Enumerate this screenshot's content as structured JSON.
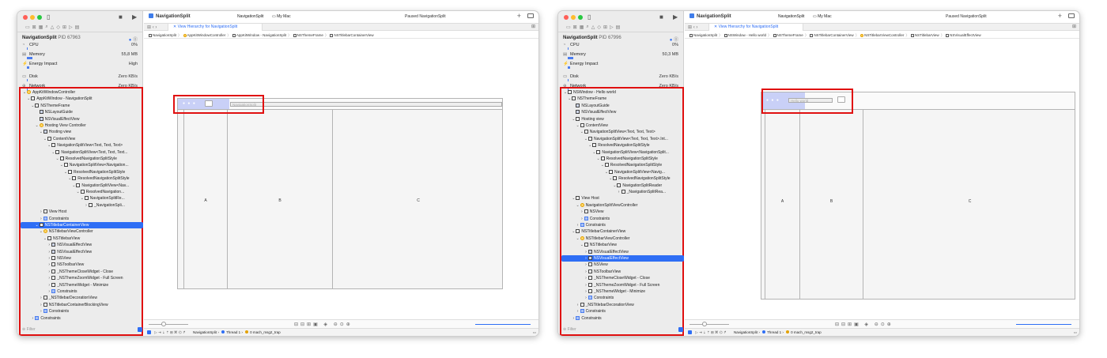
{
  "windows": [
    {
      "app_name": "NavigationSplit",
      "scheme": "NavigationSplit",
      "destination": "My Mac",
      "status": "Paused NavigationSplit",
      "tab_label": "View Hierarchy for NavigationSplit",
      "process_name": "NavigationSplit",
      "pid": "PID 67963",
      "gauges": [
        {
          "label": "CPU",
          "value": "0%",
          "fill": 0.0
        },
        {
          "label": "Memory",
          "value": "55,8 MB",
          "fill": 0.12
        },
        {
          "label": "Energy Impact",
          "value": "High",
          "fill": 0.05
        },
        {
          "label": "Disk",
          "value": "Zero KB/s",
          "fill": 0.0
        },
        {
          "label": "Network",
          "value": "Zero KB/s",
          "fill": 0.0
        }
      ],
      "breadcrumbs": [
        "NavigationSplit",
        "AppKitWindowController",
        "AppKitWindow - NavigationSplit",
        "NSThemeFrame",
        "NSTitlebarContainerView"
      ],
      "breadcrumb_kinds": [
        "",
        "o",
        "",
        "",
        ""
      ],
      "tree": [
        {
          "d": 0,
          "t": "AppKitWindowController",
          "k": "vc",
          "o": "v"
        },
        {
          "d": 1,
          "t": "AppKitWindow - NavigationSplit",
          "k": "box",
          "o": "v"
        },
        {
          "d": 2,
          "t": "NSThemeFrame",
          "k": "box",
          "o": "v"
        },
        {
          "d": 3,
          "t": "NSLayoutGuide",
          "k": "fx",
          "o": ""
        },
        {
          "d": 3,
          "t": "NSVisualEffectView",
          "k": "fx",
          "o": ""
        },
        {
          "d": 3,
          "t": "Hosting View Controller",
          "k": "vc",
          "o": "v"
        },
        {
          "d": 4,
          "t": "Hosting view",
          "k": "fx",
          "o": "v"
        },
        {
          "d": 5,
          "t": "ContentView",
          "k": "box",
          "o": "v"
        },
        {
          "d": 6,
          "t": "NavigationSplitView<Text, Text, Text>",
          "k": "box",
          "o": "v"
        },
        {
          "d": 7,
          "t": "NavigationSplitView<Text, Text, Text...",
          "k": "box",
          "o": "v"
        },
        {
          "d": 8,
          "t": "ResolvedNavigationSplitStyle",
          "k": "box",
          "o": "v"
        },
        {
          "d": 9,
          "t": "NavigationSplitView<Navigation...",
          "k": "box",
          "o": "v"
        },
        {
          "d": 10,
          "t": "ResolvedNavigationSplitStyle",
          "k": "box",
          "o": "v"
        },
        {
          "d": 11,
          "t": "ResolvedNavigationSplitStyle",
          "k": "box",
          "o": "v"
        },
        {
          "d": 12,
          "t": "NavigationSplitView<Nav...",
          "k": "box",
          "o": "v"
        },
        {
          "d": 13,
          "t": "ResolvedNavigation...",
          "k": "box",
          "o": "v"
        },
        {
          "d": 14,
          "t": "NavigationSplitRe...",
          "k": "box",
          "o": "v"
        },
        {
          "d": 15,
          "t": "_NavigationSpli...",
          "k": "box",
          "o": ">"
        },
        {
          "d": 4,
          "t": "View Host",
          "k": "box",
          "o": ">"
        },
        {
          "d": 4,
          "t": "Constraints",
          "k": "cs",
          "o": ">"
        },
        {
          "d": 3,
          "t": "NSTitlebarContainerView",
          "k": "box",
          "o": "v",
          "sel": true
        },
        {
          "d": 4,
          "t": "NSTitlebarViewController",
          "k": "vc",
          "o": "v"
        },
        {
          "d": 5,
          "t": "NSTitlebarView",
          "k": "box",
          "o": "v"
        },
        {
          "d": 6,
          "t": "NSVisualEffectView",
          "k": "fx",
          "o": ">"
        },
        {
          "d": 6,
          "t": "NSVisualEffectView",
          "k": "fx",
          "o": ">"
        },
        {
          "d": 6,
          "t": "NSView",
          "k": "box",
          "o": ">"
        },
        {
          "d": 6,
          "t": "NSToolbarView",
          "k": "box",
          "o": ">"
        },
        {
          "d": 6,
          "t": "_NSThemeCloseWidget - Close",
          "k": "box",
          "o": ">"
        },
        {
          "d": 6,
          "t": "_NSThemeZoomWidget - Full Screen",
          "k": "box",
          "o": ">"
        },
        {
          "d": 6,
          "t": "_NSThemeWidget - Minimize",
          "k": "box",
          "o": ">"
        },
        {
          "d": 6,
          "t": "Constraints",
          "k": "cs",
          "o": ">"
        },
        {
          "d": 4,
          "t": "_NSTitlebarDecorationView",
          "k": "box",
          "o": ">"
        },
        {
          "d": 4,
          "t": "NSTitlebarContainerBlockingView",
          "k": "box",
          "o": ">"
        },
        {
          "d": 4,
          "t": "Constraints",
          "k": "cs",
          "o": ">"
        },
        {
          "d": 2,
          "t": "Constraints",
          "k": "cs",
          "o": ">"
        }
      ],
      "filter_placeholder": "Filter",
      "title_field": "NavigationSplit",
      "columns": [
        "A",
        "B",
        "C"
      ],
      "debug": {
        "target": "NavigationSplit",
        "thread": "Thread 1",
        "frame": "0 mach_msg2_trap"
      }
    },
    {
      "app_name": "NavigationSplit",
      "scheme": "NavigationSplit",
      "destination": "My Mac",
      "status": "Paused NavigationSplit",
      "tab_label": "View Hierarchy for NavigationSplit",
      "process_name": "NavigationSplit",
      "pid": "PID 67996",
      "gauges": [
        {
          "label": "CPU",
          "value": "0%",
          "fill": 0.0
        },
        {
          "label": "Memory",
          "value": "50,3 MB",
          "fill": 0.12
        },
        {
          "label": "Energy Impact",
          "value": "",
          "fill": 0.05
        },
        {
          "label": "Disk",
          "value": "Zero KB/s",
          "fill": 0.0
        },
        {
          "label": "Network",
          "value": "Zero KB/s",
          "fill": 0.0
        }
      ],
      "breadcrumbs": [
        "NavigationSplit",
        "NSWindow - Hello world",
        "NSThemeFrame",
        "NSTitlebarContainerView",
        "NSTitlebarViewController",
        "NSTitlebarView",
        "NSVisualEffectView"
      ],
      "breadcrumb_kinds": [
        "",
        "",
        "",
        "",
        "o",
        "",
        ""
      ],
      "tree": [
        {
          "d": 0,
          "t": "NSWindow - Hello world",
          "k": "box",
          "o": "v"
        },
        {
          "d": 1,
          "t": "NSThemeFrame",
          "k": "box",
          "o": "v"
        },
        {
          "d": 2,
          "t": "NSLayoutGuide",
          "k": "fx",
          "o": ""
        },
        {
          "d": 2,
          "t": "NSVisualEffectView",
          "k": "fx",
          "o": ""
        },
        {
          "d": 2,
          "t": "Hosting view",
          "k": "box",
          "o": "v"
        },
        {
          "d": 3,
          "t": "ContentView",
          "k": "box",
          "o": "v"
        },
        {
          "d": 4,
          "t": "NavigationSplitView<Text, Text, Text>",
          "k": "box",
          "o": "v"
        },
        {
          "d": 5,
          "t": "NavigationSplitView<Text, Text, Text>.Int...",
          "k": "box",
          "o": "v"
        },
        {
          "d": 6,
          "t": "ResolvedNavigationSplitStyle",
          "k": "box",
          "o": "v"
        },
        {
          "d": 7,
          "t": "NavigationSplitView<NavigationSplit...",
          "k": "box",
          "o": "v"
        },
        {
          "d": 8,
          "t": "ResolvedNavigationSplitStyle",
          "k": "box",
          "o": "v"
        },
        {
          "d": 9,
          "t": "ResolvedNavigationSplitStyle",
          "k": "box",
          "o": "v"
        },
        {
          "d": 10,
          "t": "NavigationSplitView<Navig...",
          "k": "box",
          "o": "v"
        },
        {
          "d": 11,
          "t": "ResolvedNavigationSplitStyle",
          "k": "box",
          "o": "v"
        },
        {
          "d": 12,
          "t": "NavigationSplitReader",
          "k": "box",
          "o": "v"
        },
        {
          "d": 13,
          "t": "_NavigationSplitRea...",
          "k": "box",
          "o": ">"
        },
        {
          "d": 2,
          "t": "View Host",
          "k": "box",
          "o": "v"
        },
        {
          "d": 3,
          "t": "NavigationSplitViewController",
          "k": "vc",
          "o": "v"
        },
        {
          "d": 4,
          "t": "NSView",
          "k": "box",
          "o": ">"
        },
        {
          "d": 4,
          "t": "Constraints",
          "k": "cs",
          "o": ">"
        },
        {
          "d": 3,
          "t": "Constraints",
          "k": "cs",
          "o": ">"
        },
        {
          "d": 2,
          "t": "NSTitlebarContainerView",
          "k": "box",
          "o": "v"
        },
        {
          "d": 3,
          "t": "NSTitlebarViewController",
          "k": "vc",
          "o": "v"
        },
        {
          "d": 4,
          "t": "NSTitlebarView",
          "k": "box",
          "o": "v"
        },
        {
          "d": 5,
          "t": "NSVisualEffectView",
          "k": "fx",
          "o": ">"
        },
        {
          "d": 5,
          "t": "NSVisualEffectView",
          "k": "fx",
          "o": ">",
          "sel": true
        },
        {
          "d": 5,
          "t": "NSView",
          "k": "box",
          "o": ">"
        },
        {
          "d": 5,
          "t": "NSToolbarView",
          "k": "box",
          "o": ">"
        },
        {
          "d": 5,
          "t": "_NSThemeCloseWidget - Close",
          "k": "box",
          "o": ">"
        },
        {
          "d": 5,
          "t": "_NSThemeZoomWidget - Full Screen",
          "k": "box",
          "o": ">"
        },
        {
          "d": 5,
          "t": "_NSThemeWidget - Minimize",
          "k": "box",
          "o": ">"
        },
        {
          "d": 5,
          "t": "Constraints",
          "k": "cs",
          "o": ">"
        },
        {
          "d": 3,
          "t": "_NSTitlebarDecorationView",
          "k": "box",
          "o": ">"
        },
        {
          "d": 3,
          "t": "Constraints",
          "k": "cs",
          "o": ">"
        },
        {
          "d": 2,
          "t": "Constraints",
          "k": "cs",
          "o": ">"
        }
      ],
      "filter_placeholder": "Filter",
      "title_field": "Hello world",
      "columns": [
        "A",
        "B",
        "C"
      ],
      "debug": {
        "target": "NavigationSplit",
        "thread": "Thread 1",
        "frame": "0 mach_msg2_trap"
      }
    }
  ],
  "colors": {
    "accent": "#2e6ef5",
    "highlight": "#e01010",
    "overlay": "#c3cbf6"
  },
  "icons": {
    "run": "play-icon",
    "stop": "stop-icon",
    "sidebar": "sidebar-toggle-icon",
    "add": "plus-icon"
  }
}
